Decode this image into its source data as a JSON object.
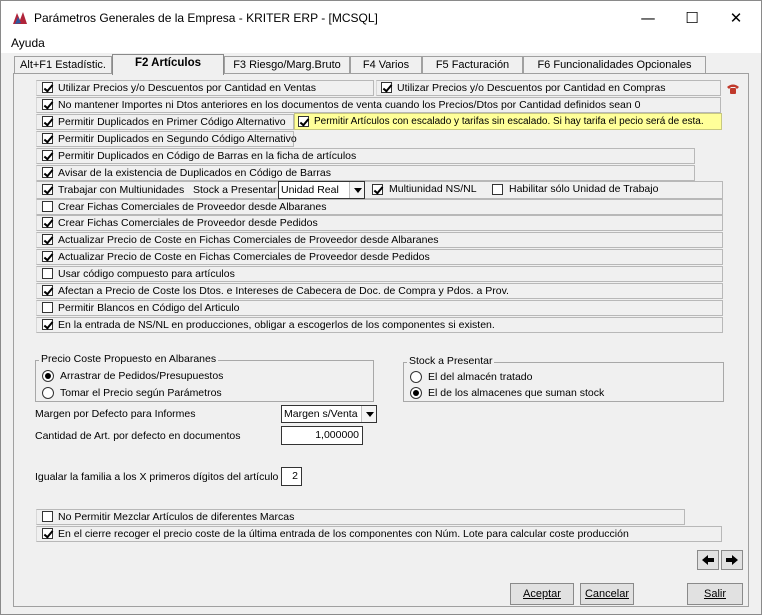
{
  "window": {
    "title": "Parámetros Generales de la Empresa - KRITER ERP - [MCSQL]",
    "minimize": "—",
    "maximize": "☐",
    "close": "✕"
  },
  "menu": {
    "ayuda": "Ayuda"
  },
  "tabs": [
    {
      "label": "Alt+F1 Estadístic."
    },
    {
      "label": "F2 Artículos"
    },
    {
      "label": "F3 Riesgo/Marg.Bruto"
    },
    {
      "label": "F4 Varios"
    },
    {
      "label": "F5 Facturación"
    },
    {
      "label": "F6 Funcionalidades Opcionales"
    }
  ],
  "options": {
    "precios_ventas": {
      "label": "Utilizar Precios y/o Descuentos por Cantidad en Ventas",
      "checked": true
    },
    "precios_compras": {
      "label": "Utilizar Precios y/o Descuentos por Cantidad en Compras",
      "checked": true
    },
    "no_mantener": {
      "label": "No mantener Importes ni Dtos anteriores en los documentos de venta cuando los Precios/Dtos por Cantidad definidos sean 0",
      "checked": true
    },
    "dup_primer": {
      "label": "Permitir Duplicados en Primer Código Alternativo",
      "checked": true
    },
    "escalado": {
      "label": "Permitir Artículos con escalado y tarifas sin escalado. Si hay tarifa el pecio será de esta.",
      "checked": true
    },
    "dup_segundo": {
      "label": "Permitir Duplicados en Segundo Código Alternativo",
      "checked": true
    },
    "dup_barras": {
      "label": "Permitir Duplicados en Código de Barras en la ficha de artículos",
      "checked": true
    },
    "avisar_barras": {
      "label": "Avisar de la existencia de Duplicados en Código de Barras",
      "checked": true
    },
    "multiunidades": {
      "label": "Trabajar con Multiunidades",
      "checked": true
    },
    "stock_presentar_label": "Stock a Presentar",
    "stock_presentar_value": "Unidad Real",
    "multiunidad_nsnl": {
      "label": "Multiunidad NS/NL",
      "checked": true
    },
    "solo_unidad_trabajo": {
      "label": "Habilitar sólo Unidad de Trabajo",
      "checked": false
    },
    "fichas_albaranes": {
      "label": "Crear Fichas Comerciales de Proveedor desde Albaranes",
      "checked": false
    },
    "fichas_pedidos": {
      "label": "Crear Fichas Comerciales de Proveedor desde Pedidos",
      "checked": true
    },
    "coste_albaranes": {
      "label": "Actualizar Precio de Coste en Fichas Comerciales de Proveedor desde Albaranes",
      "checked": true
    },
    "coste_pedidos": {
      "label": "Actualizar Precio de Coste en Fichas Comerciales de Proveedor desde Pedidos",
      "checked": true
    },
    "codigo_compuesto": {
      "label": "Usar código compuesto para artículos",
      "checked": false
    },
    "afectan_precio": {
      "label": "Afectan a Precio de Coste los Dtos. e Intereses de Cabecera de Doc. de Compra y Pdos. a Prov.",
      "checked": true
    },
    "blancos": {
      "label": "Permitir Blancos en Código del Articulo",
      "checked": false
    },
    "nsnl_producciones": {
      "label": "En la entrada de NS/NL en producciones, obligar a escogerlos de los componentes si existen.",
      "checked": true
    }
  },
  "precio_coste": {
    "legend": "Precio Coste Propuesto en Albaranes",
    "opt1": "Arrastrar de Pedidos/Presupuestos",
    "opt2": "Tomar el Precio según Parámetros",
    "selected": 1
  },
  "stock_group": {
    "legend": "Stock a Presentar",
    "opt1": "El del almacén tratado",
    "opt2": "El de los almacenes que suman stock",
    "selected": 2
  },
  "margen": {
    "label": "Margen por Defecto para Informes",
    "value": "Margen s/Venta"
  },
  "cantidad": {
    "label": "Cantidad de Art. por defecto en documentos",
    "value": "1,000000"
  },
  "familia": {
    "label": "Igualar la familia a los X primeros dígitos del artículo",
    "value": "2"
  },
  "bottom_options": {
    "no_mezclar": {
      "label": "No Permitir Mezclar Artículos de diferentes Marcas",
      "checked": false
    },
    "cierre": {
      "label": "En el cierre recoger el precio coste de la última entrada de los componentes con Núm. Lote para calcular coste producción",
      "checked": true
    }
  },
  "buttons": {
    "aceptar": "Aceptar",
    "cancelar": "Cancelar",
    "salir": "Salir"
  },
  "colors": {
    "highlight": "#ffff99",
    "accent_icon": "#c0392b"
  }
}
